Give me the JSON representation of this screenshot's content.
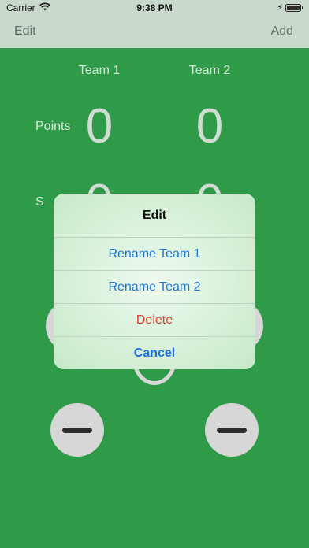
{
  "status_bar": {
    "carrier": "Carrier",
    "time": "9:38 PM",
    "icons": [
      "wifi-icon",
      "charging-icon",
      "battery-icon"
    ]
  },
  "nav": {
    "left_button": "Edit",
    "right_button": "Add"
  },
  "scoreboard": {
    "team1_label": "Team 1",
    "team2_label": "Team 2",
    "points_label": "Points",
    "partial_label": "S",
    "team1_points": "0",
    "team2_points": "0",
    "team1_second": "0",
    "team2_second": "0"
  },
  "alert": {
    "title": "Edit",
    "actions": [
      {
        "label": "Rename Team 1",
        "style": "default"
      },
      {
        "label": "Rename Team 2",
        "style": "default"
      },
      {
        "label": "Delete",
        "style": "destructive"
      },
      {
        "label": "Cancel",
        "style": "cancel"
      }
    ]
  },
  "colors": {
    "background": "#2f9b48",
    "bar": "#c9d9cc",
    "action_blue": "#1a73d9",
    "destructive_red": "#e0392c"
  }
}
